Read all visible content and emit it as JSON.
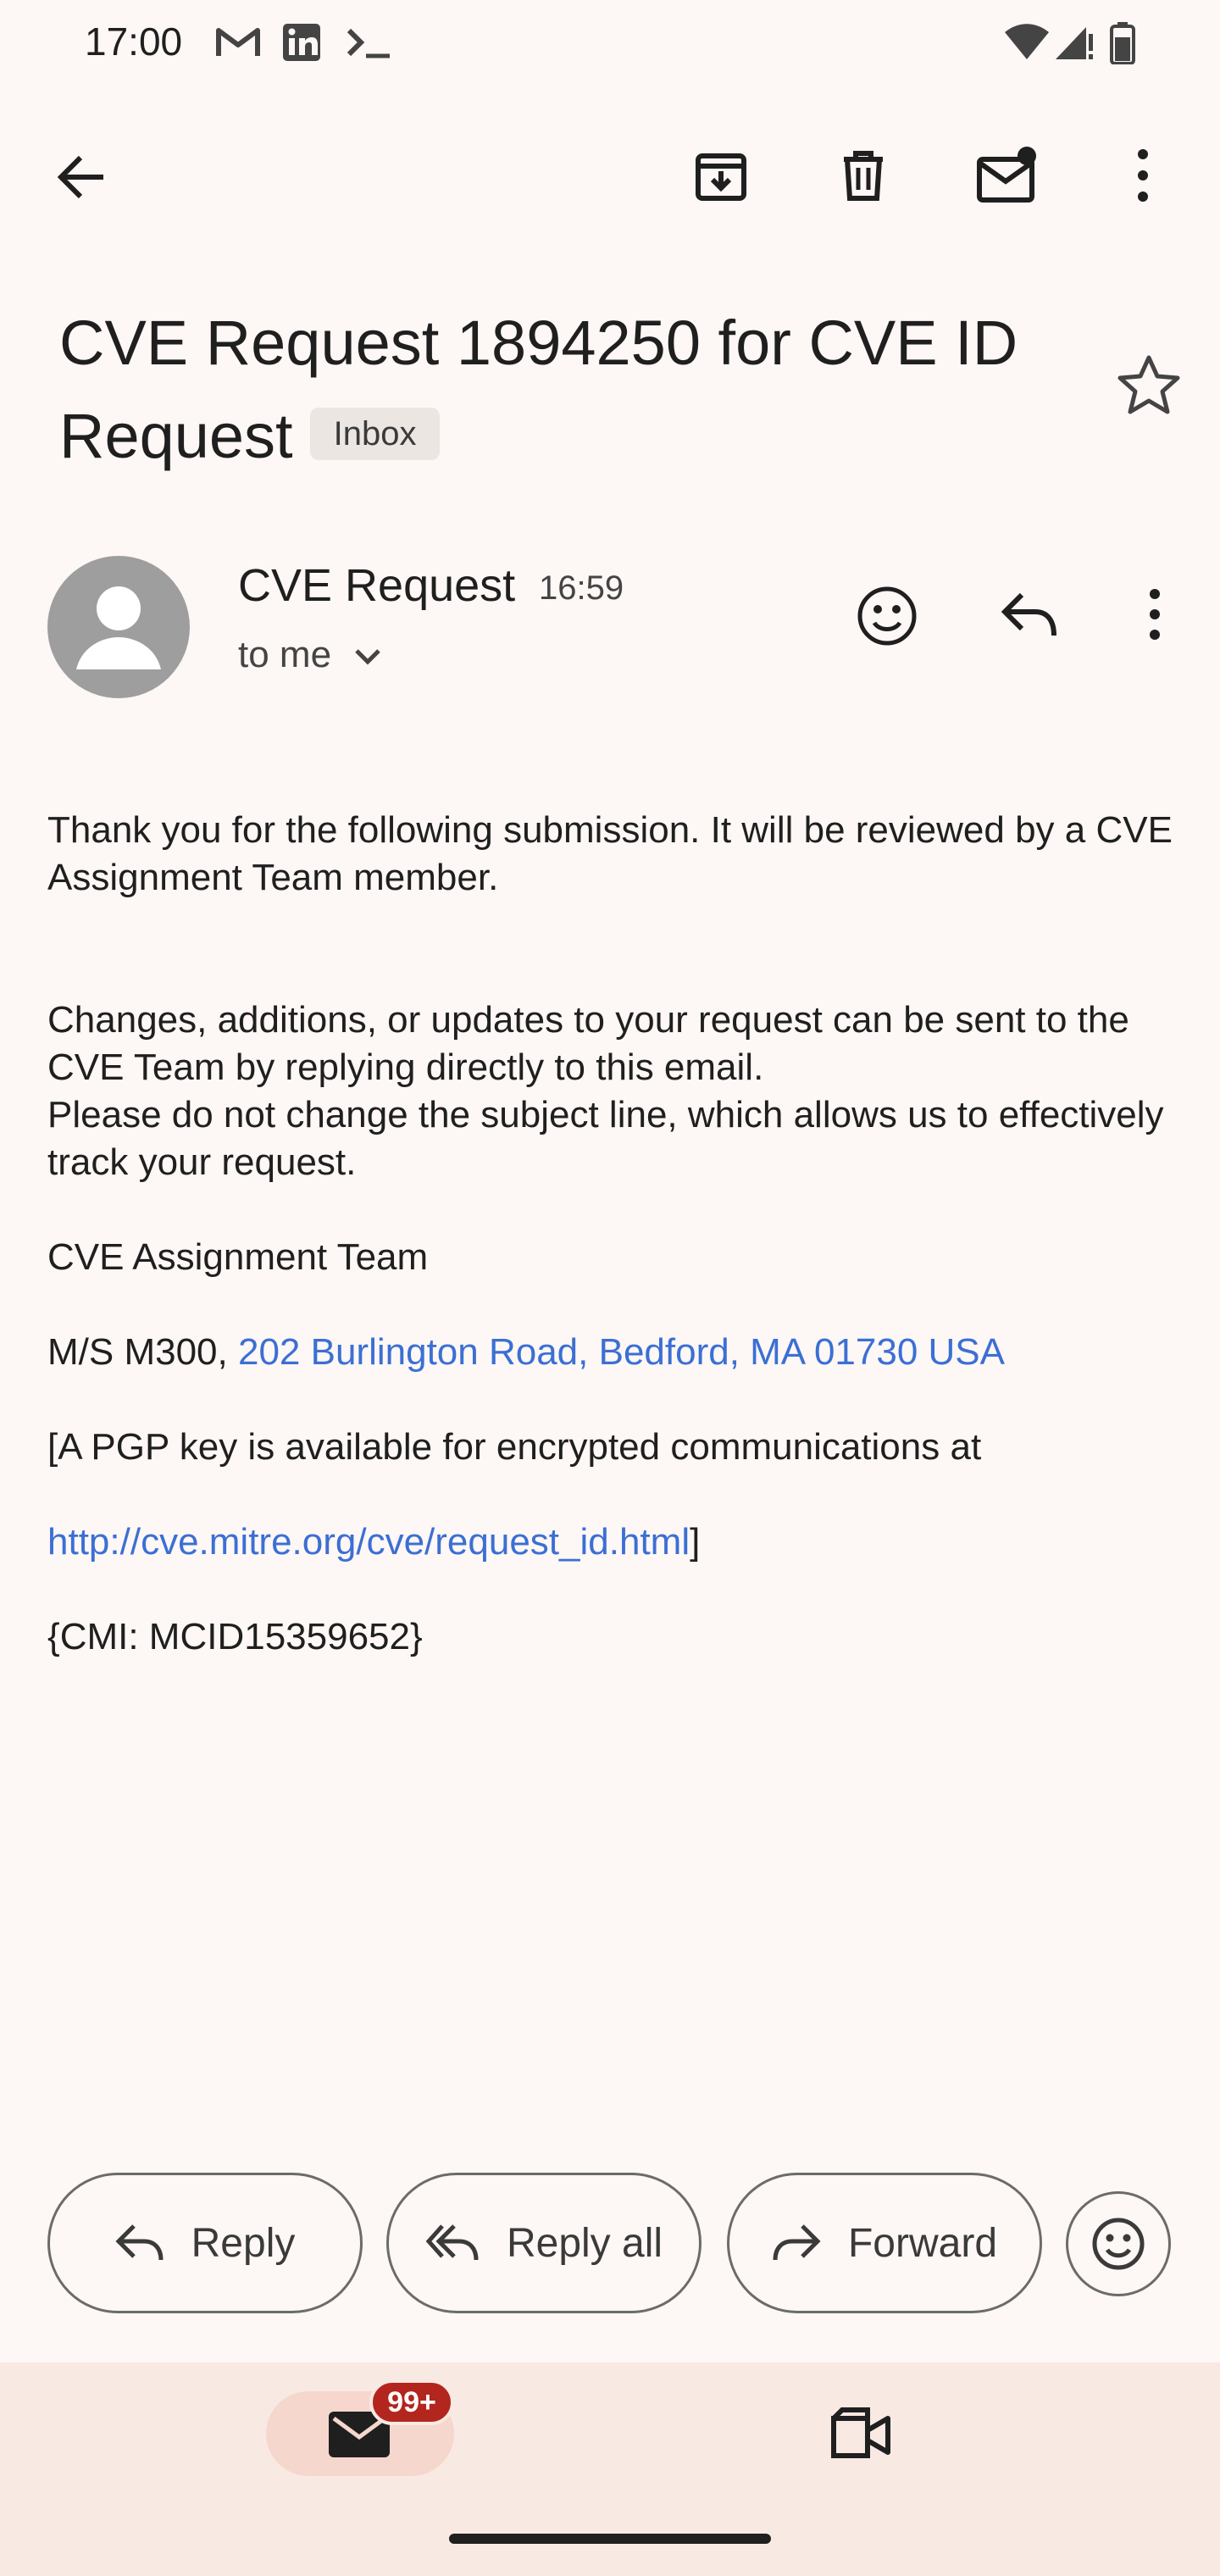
{
  "status_bar": {
    "time": "17:00",
    "icons": [
      "gmail-icon",
      "linkedin-icon",
      "terminal-icon",
      "wifi-icon",
      "signal-icon",
      "battery-icon"
    ]
  },
  "toolbar": {
    "icons": [
      "back-arrow-icon",
      "archive-icon",
      "delete-icon",
      "mark-unread-icon",
      "more-vert-icon"
    ]
  },
  "email": {
    "subject": "CVE Request 1894250 for CVE ID Request",
    "label": "Inbox",
    "sender": "CVE Request",
    "time": "16:59",
    "to": "to me",
    "body": {
      "p1": "Thank you for the following submission. It will be reviewed by a CVE Assignment Team member.",
      "p2": "Changes, additions, or updates to your request can be sent to the CVE Team by replying directly to this email.",
      "p3": "Please do not change the subject line, which allows us to effectively track your request.",
      "signature": "CVE Assignment Team",
      "address_prefix": "M/S M300, ",
      "address_link": "202 Burlington Road, Bedford, MA 01730 USA",
      "pgp_line": "[A PGP key is available for encrypted communications at",
      "pgp_link": "http://cve.mitre.org/cve/request_id.html",
      "pgp_close": "]",
      "cmi": "{CMI: MCID15359652}"
    }
  },
  "actions": {
    "reply": "Reply",
    "reply_all": "Reply all",
    "forward": "Forward"
  },
  "bottom_nav": {
    "mail_badge": "99+"
  },
  "colors": {
    "background": "#fdf7f5",
    "link": "#3b6fd4",
    "badge": "#b3261e",
    "nav_background": "#f9e9e3"
  }
}
